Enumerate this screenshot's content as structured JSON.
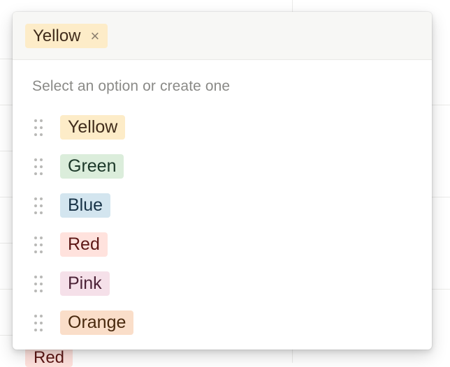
{
  "background": {
    "visible_chip": {
      "label": "Red",
      "color": "#ffe2dd",
      "text_color": "#5d1715"
    }
  },
  "selector": {
    "selected": [
      {
        "label": "Yellow",
        "color": "#fdecc8",
        "text_color": "#402c1b",
        "remove_icon": "×"
      }
    ],
    "hint": "Select an option or create one",
    "options": [
      {
        "label": "Yellow",
        "color": "#fdecc8",
        "text_color": "#402c1b"
      },
      {
        "label": "Green",
        "color": "#dbeddb",
        "text_color": "#1c3829"
      },
      {
        "label": "Blue",
        "color": "#d3e5ef",
        "text_color": "#183347"
      },
      {
        "label": "Red",
        "color": "#ffe2dd",
        "text_color": "#5d1715"
      },
      {
        "label": "Pink",
        "color": "#f5e0e9",
        "text_color": "#4c2337"
      },
      {
        "label": "Orange",
        "color": "#fadec9",
        "text_color": "#49290e"
      }
    ]
  }
}
